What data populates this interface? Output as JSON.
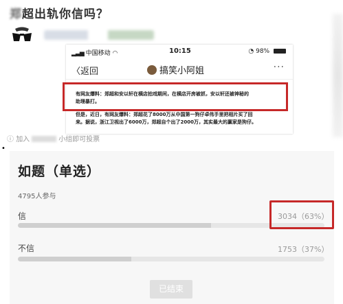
{
  "post": {
    "title": "郑超出轨你信吗？",
    "title_blurred_char": "郑"
  },
  "screenshot": {
    "status": {
      "carrier": "中国移动",
      "time": "10:15",
      "battery": "98%"
    },
    "nav": {
      "back": "返回",
      "account": "搞笑小阿姐",
      "more": "···"
    },
    "article_lines": [
      "有网友爆料：郑超和安以轩在横店拍戏期间，在横店开房被抓，安以轩还被神秘的",
      "助理暴打。",
      "但是，近日，有网友爆料：郑超花了8000万从中国第一狗仔卓伟手里把相片买了回",
      "来。据说，浙江卫视出了6000万，郑超自个出了2000万，其实最大的赢家是狗仔。"
    ]
  },
  "join": {
    "prefix": "加入",
    "suffix": "小组即可投票"
  },
  "poll": {
    "title": "如题（单选）",
    "participants": "4795人参与",
    "options": [
      {
        "label": "信",
        "stat": "3034（63%）",
        "percent": 63
      },
      {
        "label": "不信",
        "stat": "1753（37%）",
        "percent": 37
      }
    ],
    "ended_label": "已结束"
  }
}
